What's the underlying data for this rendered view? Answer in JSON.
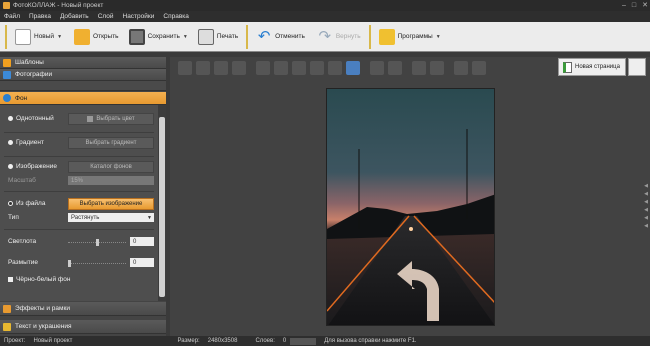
{
  "window": {
    "title": "ФотоКОЛЛАЖ - Новый проект"
  },
  "menu": [
    "Файл",
    "Правка",
    "Добавить",
    "Слой",
    "Настройки",
    "Справка"
  ],
  "toolbar": {
    "new": "Новый",
    "open": "Открыть",
    "save": "Сохранить",
    "print": "Печать",
    "undo": "Отменить",
    "redo": "Вернуть",
    "programs": "Программы"
  },
  "sidebar": {
    "templates": "Шаблоны",
    "photos": "Фотографии",
    "background": "Фон",
    "effects": "Эффекты и рамки",
    "text": "Текст и украшения"
  },
  "background_panel": {
    "solid": "Однотонный",
    "pick_color": "Выбрать цвет",
    "gradient": "Градиент",
    "pick_gradient": "Выбрать градиент",
    "image": "Изображение",
    "bg_catalog": "Каталог фонов",
    "scale_label": "Масштаб",
    "scale_value": "15%",
    "from_file": "Из файла",
    "choose_image": "Выбрать изображение",
    "type_label": "Тип",
    "type_value": "Растянуть",
    "brightness_label": "Светлота",
    "brightness_value": "0",
    "blur_label": "Размытие",
    "blur_value": "0",
    "bw_label": "Чёрно-белый фон"
  },
  "workarea": {
    "new_page": "Новая страница"
  },
  "status": {
    "project": "Проект:",
    "project_name": "Новый проект",
    "size_label": "Размер:",
    "size_value": "2480x3508",
    "layers_label": "Слоев:",
    "layers_value": "0",
    "hint": "Для вызова справки нажмите F1."
  },
  "colors": {
    "accent": "#e89a30",
    "toolbar_bg": "#ececec",
    "separator": "#d8b84a"
  }
}
